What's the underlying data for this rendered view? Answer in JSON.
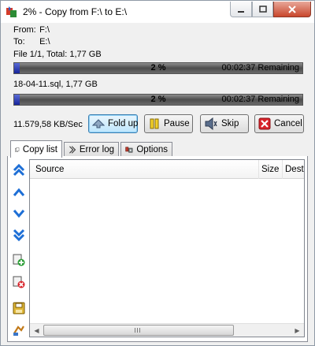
{
  "window": {
    "title": "2% - Copy from F:\\ to E:\\"
  },
  "info": {
    "from_label": "From:",
    "from_value": "F:\\",
    "to_label": "To:",
    "to_value": "E:\\",
    "file_line": "File 1/1, Total: 1,77 GB",
    "current_file": "18-04-11.sql, 1,77 GB"
  },
  "progress_total": {
    "percent": 2,
    "percent_text": "2 %",
    "remaining_text": "00:02:37 Remaining"
  },
  "progress_file": {
    "percent": 2,
    "percent_text": "2 %",
    "remaining_text": "00:02:37 Remaining"
  },
  "speed": "11.579,58 KB/Sec",
  "buttons": {
    "fold_up": "Fold up",
    "pause": "Pause",
    "skip": "Skip",
    "cancel": "Cancel"
  },
  "tabs": [
    {
      "label": "Copy list",
      "active": true
    },
    {
      "label": "Error log",
      "active": false
    },
    {
      "label": "Options",
      "active": false
    }
  ],
  "list": {
    "columns": [
      "Source",
      "Size",
      "Destin"
    ]
  },
  "colors": {
    "accent_blue": "#1e6fd6",
    "progress_fill": "#16239a",
    "cancel_red": "#d8232a"
  }
}
